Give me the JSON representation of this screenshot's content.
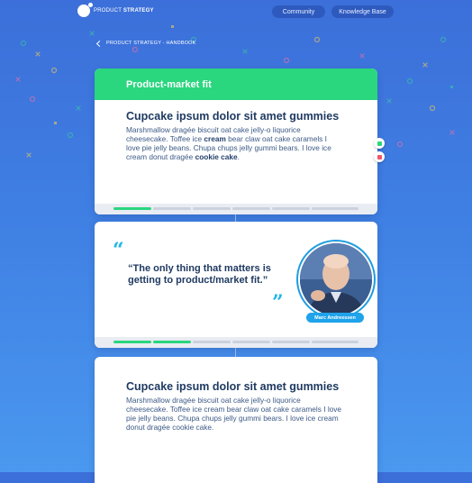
{
  "colors": {
    "accent_green": "#2ad67e",
    "heading_navy": "#1f3a62",
    "quote_blue": "#1fb5e5",
    "background_blue": "#3f7fe3"
  },
  "header": {
    "logo_icon": "mascot-logo-icon",
    "brand_light": "PRODUCT",
    "brand_bold": "STRATEGY",
    "nav": [
      {
        "label": "Community"
      },
      {
        "label": "Knowledge Base"
      }
    ]
  },
  "breadcrumb": {
    "back_icon": "chevron-left-icon",
    "label": "PRODUCT STRATEGY - HANDBOOK"
  },
  "cards": [
    {
      "header": "Product-market fit",
      "title": "Cupcake ipsum dolor sit amet gummies",
      "body_parts": [
        "Marshmallow dragée biscuit oat cake jelly-o liquorice cheesecake. Toffee ice ",
        "cream",
        " bear claw oat cake caramels I love pie jelly beans. Chupa chups jelly gummi bears. I love ice cream donut dragée ",
        "cookie cake",
        "."
      ],
      "progress_fraction": 0.2
    },
    {
      "quote": "“The only thing that matters is getting to product/market fit.”",
      "open_quote_glyph": "“",
      "close_quote_glyph": "”",
      "author": "Marc Andreessen",
      "progress_fraction": 0.4
    },
    {
      "title": "Cupcake ipsum dolor sit amet gummies",
      "body": "Marshmallow dragée biscuit oat cake jelly-o liquorice cheesecake. Toffee ice cream bear claw oat cake caramels I love pie jelly beans. Chupa chups jelly gummi bears. I love ice cream donut dragée cookie cake."
    }
  ],
  "votes": {
    "up_icon": "thumbs-up-icon",
    "down_icon": "thumbs-down-icon"
  }
}
